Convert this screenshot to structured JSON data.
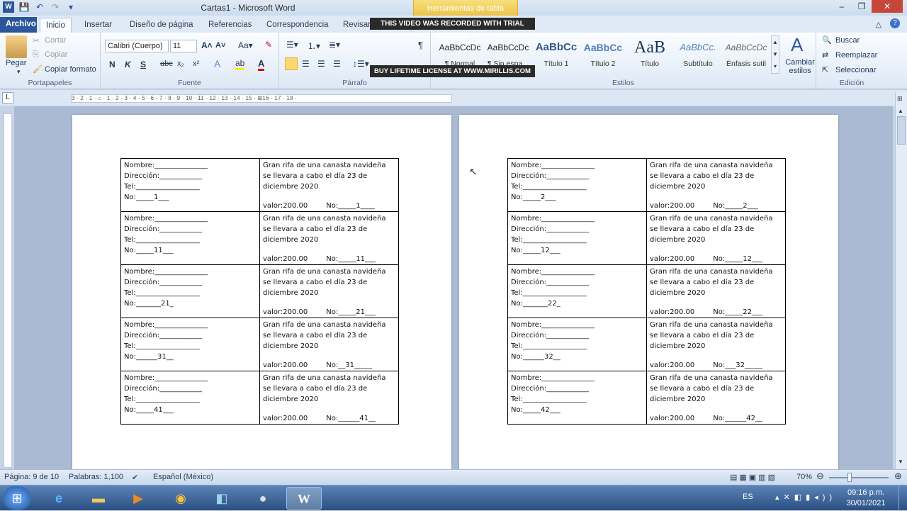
{
  "window": {
    "title": "Cartas1 - Microsoft Word",
    "context_tab": "Herramientas de tabla"
  },
  "tabs": [
    "Archivo",
    "Inicio",
    "Insertar",
    "Diseño de página",
    "Referencias",
    "Correspondencia",
    "Revisar"
  ],
  "watermark": {
    "line1": "THIS VIDEO WAS RECORDED WITH TRIAL VERSION",
    "line2": "BUY LIFETIME LICENSE AT WWW.MIRILLIS.COM"
  },
  "ribbon": {
    "clipboard": {
      "paste": "Pegar",
      "cut": "Cortar",
      "copy": "Copiar",
      "format_painter": "Copiar formato",
      "label": "Portapapeles"
    },
    "font": {
      "name": "Calibri (Cuerpo)",
      "size": "11",
      "label": "Fuente",
      "bold": "N",
      "italic": "K",
      "underline": "S",
      "strike": "abc",
      "sub": "x₂",
      "sup": "x²"
    },
    "paragraph": {
      "label": "Párrafo",
      "pilcrow": "¶"
    },
    "styles": {
      "label": "Estilos",
      "items": [
        {
          "preview": "AaBbCcDc",
          "name": "¶ Normal"
        },
        {
          "preview": "AaBbCcDc",
          "name": "¶ Sin espa..."
        },
        {
          "preview": "AaBbCc",
          "name": "Título 1"
        },
        {
          "preview": "AaBbCc",
          "name": "Título 2"
        },
        {
          "preview": "AaB",
          "name": "Título"
        },
        {
          "preview": "AaBbCc.",
          "name": "Subtítulo"
        },
        {
          "preview": "AaBbCcDc",
          "name": "Énfasis sutil"
        }
      ],
      "change": "Cambiar estilos"
    },
    "editing": {
      "label": "Edición",
      "find": "Buscar",
      "replace": "Reemplazar",
      "select": "Seleccionar"
    }
  },
  "ruler_text": "3 · 2 · 1 · ⌂ · 1 · 2 · 3 · 4 · 5 · 6 · 7 · 8 · 9 · 10 · 11 · 12 · 13 · 14 · 15 · ⊞16 · 17 · 18 ·",
  "raffle_common": {
    "nombre": "Nombre:_______________",
    "direccion": "Dirección:____________",
    "tel": "Tel:__________________",
    "prize": "Gran rifa de una canasta navideña se llevara a cabo el día 23 de diciembre 2020",
    "valor": "valor:200.00"
  },
  "pages": [
    {
      "rows": [
        {
          "no_left": "No:_____1___",
          "no_right": "No:_____1____"
        },
        {
          "no_left": "No:_____11___",
          "no_right": "No:_____11___"
        },
        {
          "no_left": "No:_______21_",
          "no_right": "No:_____21___"
        },
        {
          "no_left": "No:______31__",
          "no_right": "No:__31_____"
        },
        {
          "no_left": "No:_____41___",
          "no_right": "No:______41__"
        }
      ]
    },
    {
      "rows": [
        {
          "no_left": "No:_____2___",
          "no_right": "No:_____2___"
        },
        {
          "no_left": "No:_____12___",
          "no_right": "No:_____12___"
        },
        {
          "no_left": "No:_______22_",
          "no_right": "No:_____22___"
        },
        {
          "no_left": "No:______32__",
          "no_right": "No:___32_____"
        },
        {
          "no_left": "No:_____42___",
          "no_right": "No:______42__"
        }
      ]
    }
  ],
  "status": {
    "page": "Página: 9 de 10",
    "words": "Palabras: 1,100",
    "lang": "Español (México)",
    "zoom": "70%"
  },
  "taskbar": {
    "lang": "ES",
    "time": "09:16 p.m.",
    "date": "30/01/2021"
  }
}
